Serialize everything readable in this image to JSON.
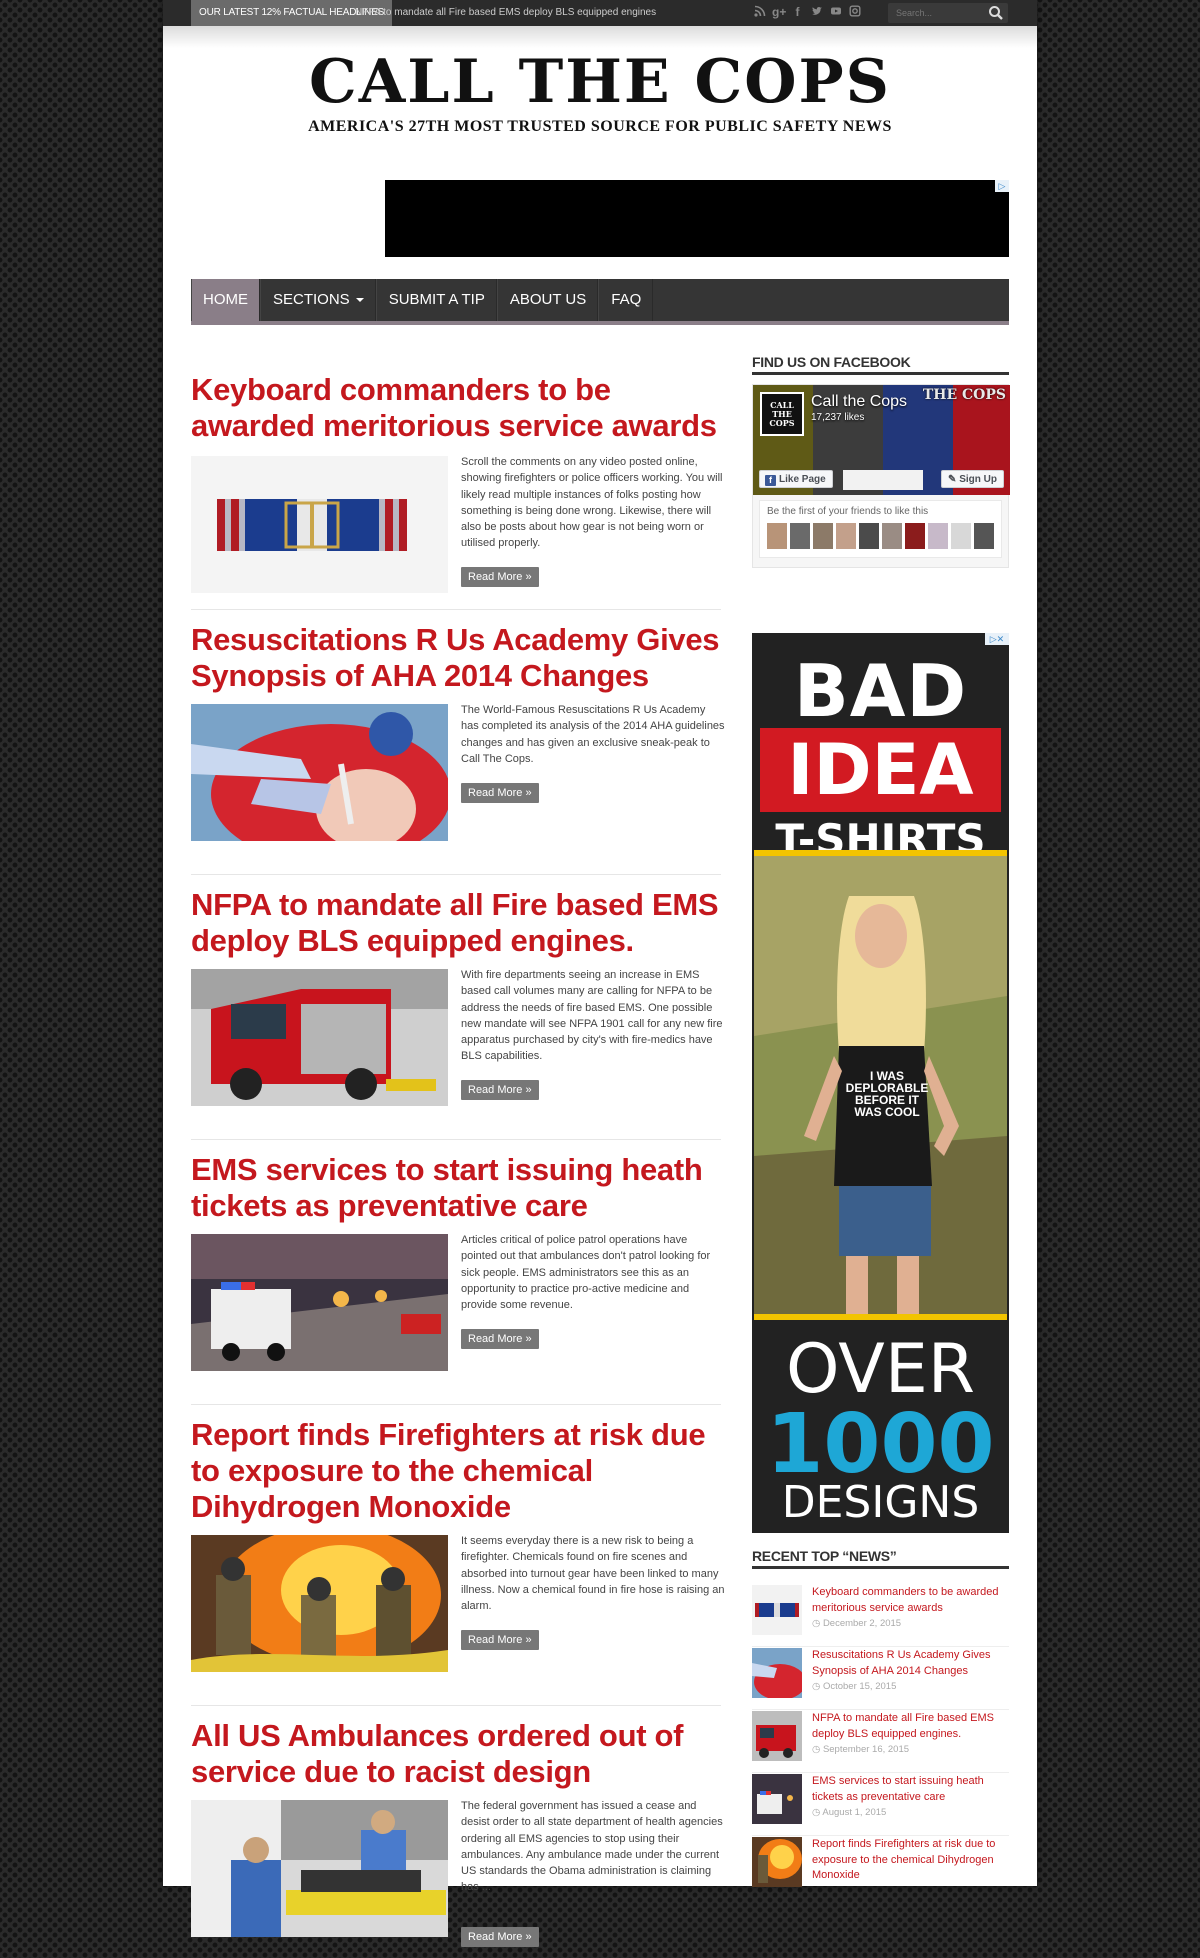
{
  "topbar": {
    "ticker_label": "OUR LATEST 12% FACTUAL HEADLINES",
    "ticker_text": "NFPA to mandate all Fire based EMS deploy BLS equipped engines",
    "search_placeholder": "Search...",
    "social_icons": [
      "rss-icon",
      "google-plus-icon",
      "facebook-icon",
      "twitter-icon",
      "youtube-icon",
      "instagram-icon"
    ]
  },
  "site": {
    "title": "CALL THE COPS",
    "tagline": "AMERICA'S 27TH MOST TRUSTED SOURCE FOR PUBLIC SAFETY NEWS"
  },
  "nav": {
    "items": [
      {
        "label": "HOME"
      },
      {
        "label": "SECTIONS"
      },
      {
        "label": "SUBMIT A TIP"
      },
      {
        "label": "ABOUT US"
      },
      {
        "label": "FAQ"
      }
    ]
  },
  "posts": [
    {
      "title": "Keyboard commanders to be awarded meritorious service awards",
      "excerpt": "Scroll the comments on any video posted online, showing firefighters or police officers working. You will likely read multiple instances of folks posting how something is being done wrong. Likewise, there will also be posts about how gear is not being worn or utilised properly.",
      "read_more": "Read More »"
    },
    {
      "title": "Resuscitations R Us Academy Gives Synopsis of AHA 2014 Changes",
      "excerpt": "The World-Famous Resuscitations R Us Academy has completed its analysis of the 2014 AHA guidelines changes and has given an exclusive sneak-peak to Call The Cops.",
      "read_more": "Read More »"
    },
    {
      "title": "NFPA to mandate all Fire based EMS deploy BLS equipped engines.",
      "excerpt": "With fire departments seeing an increase in EMS based call volumes many are calling for NFPA to be address the needs of fire based EMS. One possible new mandate will see NFPA 1901 call for any new fire apparatus purchased by city's with fire-medics have BLS capabilities.",
      "read_more": "Read More »"
    },
    {
      "title": "EMS services to start issuing heath tickets as preventative care",
      "excerpt": "Articles critical of police patrol operations have pointed out that ambulances don't patrol looking for sick people. EMS administrators see this as an opportunity to practice pro-active medicine and provide some revenue.",
      "read_more": "Read More »"
    },
    {
      "title": "Report finds Firefighters at risk due to exposure to the chemical Dihydrogen Monoxide",
      "excerpt": "It seems everyday there is a new risk to being a firefighter. Chemicals found on fire scenes and absorbed into turnout gear have been linked to many illness. Now a chemical found in fire hose is raising an alarm.",
      "read_more": "Read More »"
    },
    {
      "title": "All US Ambulances ordered out of service due to racist design",
      "excerpt": "The federal government has issued a cease and desist order to all state department of health agencies ordering all EMS agencies to stop using their ambulances. Any ambulance made under the current US standards the Obama administration is claiming has ...",
      "read_more": "Read More »"
    }
  ],
  "sidebar": {
    "facebook_title": "FIND US ON FACEBOOK",
    "fb_page_name": "Call the Cops",
    "fb_likes": "17,237 likes",
    "fb_like_button": "Like Page",
    "fb_signup": "Sign Up",
    "fb_friends_text": "Be the first of your friends to like this",
    "fb_pic_text": "CALL THE COPS",
    "fb_cover_text": "THE COPS",
    "ad": {
      "line1": "BAD",
      "line2": "IDEA",
      "line3": "T-SHIRTS",
      "shirt_text": "I WAS DEPLORABLE BEFORE IT WAS COOL",
      "line4": "OVER",
      "line5": "1000",
      "line6": "DESIGNS"
    },
    "recent_title": "RECENT TOP “NEWS”",
    "recent": [
      {
        "title": "Keyboard commanders to be awarded meritorious service awards",
        "date": "December 2, 2015"
      },
      {
        "title": "Resuscitations R Us Academy Gives Synopsis of AHA 2014 Changes",
        "date": "October 15, 2015"
      },
      {
        "title": "NFPA to mandate all Fire based EMS deploy BLS equipped engines.",
        "date": "September 16, 2015"
      },
      {
        "title": "EMS services to start issuing heath tickets as preventative care",
        "date": "August 1, 2015"
      },
      {
        "title": "Report finds Firefighters at risk due to exposure to the chemical Dihydrogen Monoxide",
        "date": ""
      }
    ]
  },
  "colors": {
    "accent": "#c4181e",
    "nav_active": "#8a7e88",
    "nav_bg": "#353535"
  }
}
